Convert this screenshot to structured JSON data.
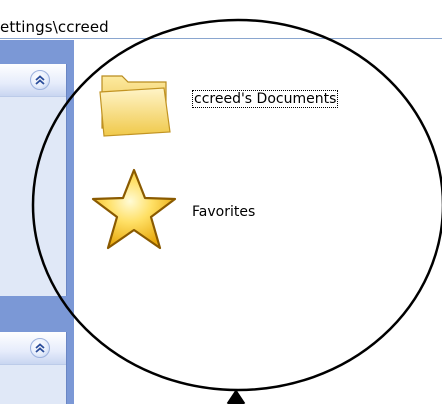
{
  "address": {
    "path": "ettings\\ccreed"
  },
  "taskpane": {
    "panels": [
      {
        "collapse_icon": "double-chevron-up-icon"
      },
      {
        "collapse_icon": "double-chevron-up-icon"
      }
    ]
  },
  "files": [
    {
      "label": "ccreed's Documents",
      "icon": "folder-icon",
      "selected": true
    },
    {
      "label": "Favorites",
      "icon": "star-icon",
      "selected": false
    }
  ],
  "annotation": {
    "shape": "circle",
    "pointer": "arrow"
  },
  "colors": {
    "taskpane_bg": "#7b98d6",
    "panel_bg": "#e0e8f7",
    "folder_yellow": "#f2d15c",
    "star_gold": "#f7c51b"
  }
}
